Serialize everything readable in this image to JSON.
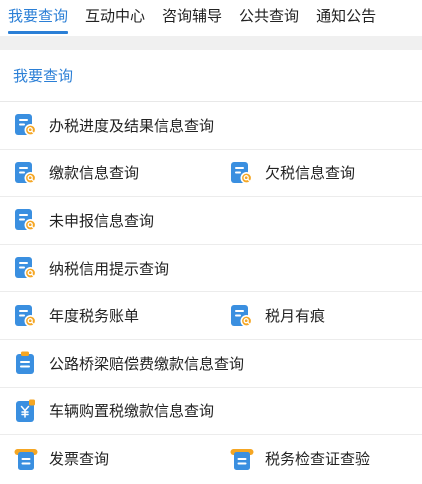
{
  "tabs": [
    {
      "label": "我要查询",
      "active": true
    },
    {
      "label": "互动中心",
      "active": false
    },
    {
      "label": "咨询辅导",
      "active": false
    },
    {
      "label": "公共查询",
      "active": false
    },
    {
      "label": "通知公告",
      "active": false
    }
  ],
  "section": {
    "title": "我要查询"
  },
  "items": {
    "progress": {
      "label": "办税进度及结果信息查询",
      "icon": "document-search-icon"
    },
    "payment": {
      "label": "缴款信息查询",
      "icon": "document-search-icon"
    },
    "arrears": {
      "label": "欠税信息查询",
      "icon": "document-search-icon"
    },
    "undeclared": {
      "label": "未申报信息查询",
      "icon": "document-search-icon"
    },
    "credit": {
      "label": "纳税信用提示查询",
      "icon": "document-search-icon"
    },
    "annual": {
      "label": "年度税务账单",
      "icon": "document-search-icon"
    },
    "monthly": {
      "label": "税月有痕",
      "icon": "document-search-icon"
    },
    "bridge": {
      "label": "公路桥梁赔偿费缴款信息查询",
      "icon": "clipboard-icon"
    },
    "vehicle": {
      "label": "车辆购置税缴款信息查询",
      "icon": "yuan-tax-icon"
    },
    "invoice": {
      "label": "发票查询",
      "icon": "invoice-icon"
    },
    "inspection": {
      "label": "税务检查证查验",
      "icon": "invoice-icon"
    }
  },
  "colors": {
    "accent": "#2b7fd6",
    "icon_blue": "#3a8fe0",
    "icon_orange": "#f5a623"
  }
}
